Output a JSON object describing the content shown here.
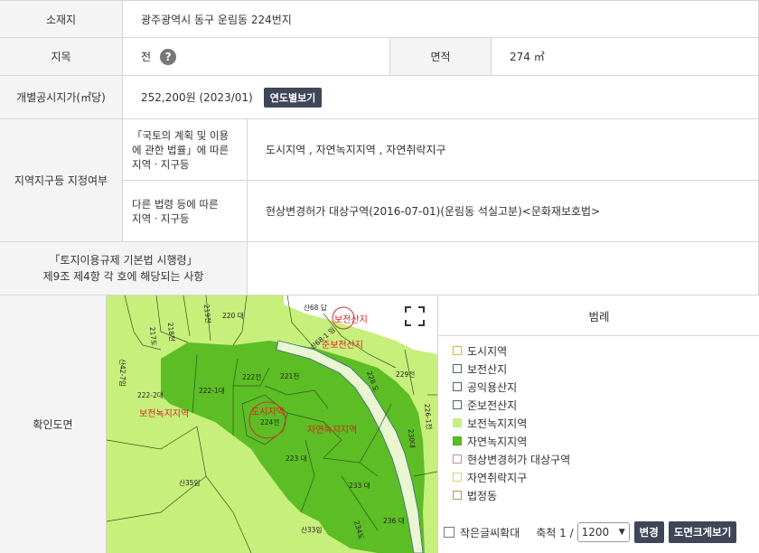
{
  "rows": {
    "location": {
      "label": "소재지",
      "value": "광주광역시 동구 운림동 224번지"
    },
    "category": {
      "label": "지목",
      "value": "전",
      "help": "?"
    },
    "area": {
      "label": "면적",
      "value": "274 ㎡"
    },
    "price": {
      "label": "개별공시지가(㎡당)",
      "value": "252,200원 (2023/01)",
      "button": "연도별보기"
    },
    "zoning": {
      "label": "지역지구등 지정여부",
      "law1_label_a": "「국토의 계획 및 이용",
      "law1_label_b": "에 관한 법률」에 따른",
      "law1_label_c": "지역ㆍ지구등",
      "law1_value": "도시지역 , 자연녹지지역 , 자연취락지구",
      "law2_label_a": "다른 법령 등에 따른",
      "law2_label_b": "지역ㆍ지구등",
      "law2_value": "현상변경허가 대상구역(2016-07-01)(운림동 석실고분)<문화재보호법>"
    },
    "decree": {
      "label_a": "「토지이용규제 기본법 시행령」",
      "label_b": "제9조 제4항 각 호에 해당되는 사항",
      "value": ""
    },
    "map_label": "확인도면"
  },
  "map": {
    "parcels": [
      "220 대",
      "219전",
      "218전",
      "217도",
      "산68 답",
      "산68-1 임",
      "222전",
      "221천",
      "222-1대",
      "222-2대",
      "224전",
      "223 대",
      "228 도",
      "229전",
      "226-1전",
      "230대",
      "산35임",
      "233 대",
      "236 대",
      "234도",
      "산42-7임",
      "산33임"
    ],
    "zone_labels": [
      "보전산지",
      "준보전산지",
      "보전녹지지역",
      "도시지역",
      "자연녹지지역"
    ]
  },
  "legend": {
    "title": "범례",
    "items": [
      {
        "label": "도시지역",
        "color": "#e5b53a",
        "fill": "#ffffff"
      },
      {
        "label": "보전산지",
        "color": "#4a6b55",
        "fill": "#ffffff"
      },
      {
        "label": "공익용산지",
        "color": "#4a6b55",
        "fill": "#ffffff"
      },
      {
        "label": "준보전산지",
        "color": "#4a6b55",
        "fill": "#ffffff"
      },
      {
        "label": "보전녹지지역",
        "color": "#c6ef7c",
        "fill": "#c6ef7c"
      },
      {
        "label": "자연녹지지역",
        "color": "#4cb020",
        "fill": "#5cbd24"
      },
      {
        "label": "현상변경허가 대상구역",
        "color": "#d48a8a",
        "fill": "#ffffff"
      },
      {
        "label": "자연취락지구",
        "color": "#e5d06a",
        "fill": "#ffffff"
      },
      {
        "label": "법정동",
        "color": "#a89a6a",
        "fill": "#ffffff"
      }
    ]
  },
  "controls": {
    "zoom_text": "작은글씨확대",
    "scale_label": "축척 1 /",
    "scale_value": "1200",
    "change_button": "변경",
    "print_button": "도면크게보기"
  }
}
